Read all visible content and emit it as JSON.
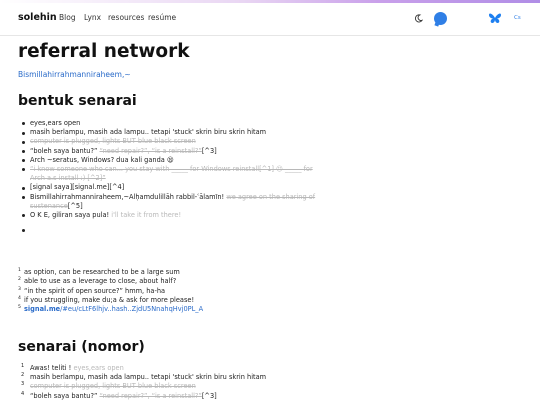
{
  "nav": {
    "brand": "solehin",
    "links": [
      "Blog",
      "Lynx",
      "resources",
      "resúme"
    ],
    "lang": "Cs"
  },
  "page": {
    "title": "referral network",
    "subtitle": "Bismillahirrahmanniraheem,~"
  },
  "section1": {
    "heading": "bentuk senarai",
    "items": [
      {
        "text": "eyes,ears open"
      },
      {
        "text": "masih berlampu, masih ada lampu.. tetapi 'stuck' skrin biru skrin hitam"
      },
      {
        "struck": "computer is plugged, lights BUT blue black screen"
      },
      {
        "text": "“boleh saya bantu?”",
        "struck": "“need repair?”, “is a reinstall?”",
        "ref": "[^3]"
      },
      {
        "text": "Arch ~seratus, Windows? dua kali ganda 😫"
      },
      {
        "struck": "“i know someone who can... you stay with _____ for Windows reinstall[^1] 😣 _____ for Arch a.s install :) [^2]”"
      },
      {
        "text": "[signal saya][signal.me][^4]"
      },
      {
        "text": "Bismillahirrahmanniraheem,~Alḥamdulillāh rabbil-ʿālamīn!",
        "struck": "we agree on the sharing of sustenance",
        "ref": "[^5]"
      },
      {
        "text": "O K E, giliran saya pula!",
        "faint": "i'll take it from there!"
      },
      {
        "text": ""
      }
    ]
  },
  "footnotes": [
    {
      "n": "1",
      "text": "as option, can be researched to be a large sum"
    },
    {
      "n": "2",
      "text": "able to use as a leverage to close, about half?"
    },
    {
      "n": "3",
      "text": "“in the spirit of open source?” hmm, ha-ha"
    },
    {
      "n": "4",
      "text": "if you struggling, make du;a & ask for more please!"
    },
    {
      "n": "5",
      "link_bold": "signal.me",
      "link_rest": "/#eu/cLtF6lhjv..hash..ZjdU5NnahqHvj0PL_A"
    }
  ],
  "section2": {
    "heading": "senarai (nomor)",
    "items": [
      {
        "n": "1",
        "text": "Awas! teliti !",
        "faint": "eyes,ears open"
      },
      {
        "n": "2",
        "text": "masih berlampu, masih ada lampu.. tetapi 'stuck' skrin biru skrin hitam"
      },
      {
        "n": "3",
        "struck": "computer is plugged, lights BUT blue black screen"
      },
      {
        "n": "4",
        "text": "“boleh saya bantu?”",
        "struck": "“need repair?”, “is a reinstall?”",
        "ref": "[^3]"
      }
    ]
  }
}
